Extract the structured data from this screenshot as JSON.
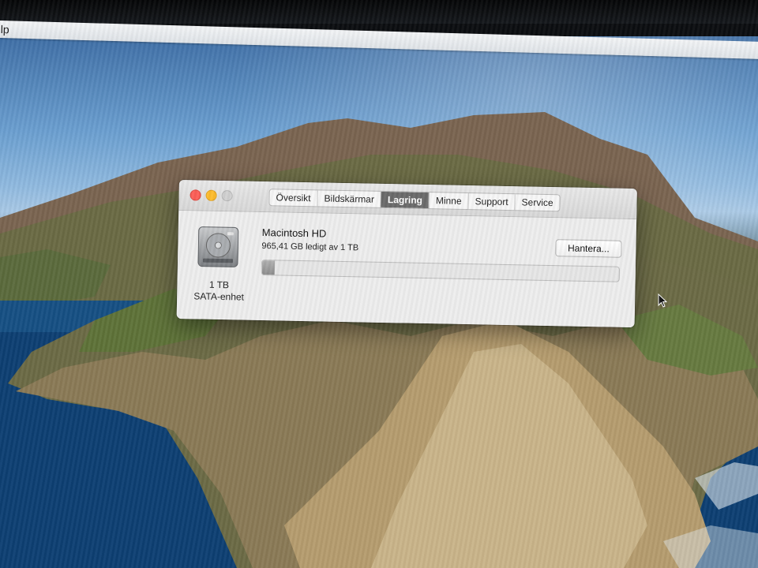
{
  "menubar": {
    "help_label": "ilp"
  },
  "window": {
    "tabs": [
      {
        "label": "Översikt"
      },
      {
        "label": "Bildskärmar"
      },
      {
        "label": "Lagring"
      },
      {
        "label": "Minne"
      },
      {
        "label": "Support"
      },
      {
        "label": "Service"
      }
    ],
    "active_tab": "Lagring",
    "disk": {
      "size": "1 TB",
      "type": "SATA-enhet",
      "icon": "hard-drive-icon"
    },
    "volume": {
      "name": "Macintosh HD",
      "free_text": "965,41 GB ledigt av 1 TB",
      "used_fraction": 0.035
    },
    "manage_button": "Hantera..."
  },
  "colors": {
    "close": "#fc5f57",
    "minimize": "#fdbc2e",
    "zoom_disabled": "#d0d0d0",
    "active_tab": "#6a6a6a"
  }
}
